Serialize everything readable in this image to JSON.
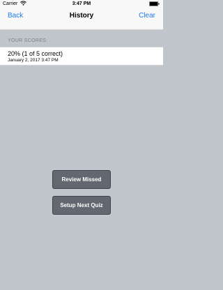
{
  "status_bar": {
    "carrier": "Carrier",
    "time": "3:47 PM",
    "wifi_icon": "wifi-icon",
    "battery_icon": "battery-icon"
  },
  "nav": {
    "back_label": "Back",
    "title": "History",
    "clear_label": "Clear",
    "accent_color": "#1a7cf6"
  },
  "scores": {
    "header": "YOUR SCORES:",
    "items": [
      {
        "score": "20% (1 of 5 correct)",
        "date": "January 2, 2017  3:47 PM"
      }
    ]
  },
  "actions": {
    "review_label": "Review Missed",
    "setup_label": "Setup Next Quiz"
  }
}
